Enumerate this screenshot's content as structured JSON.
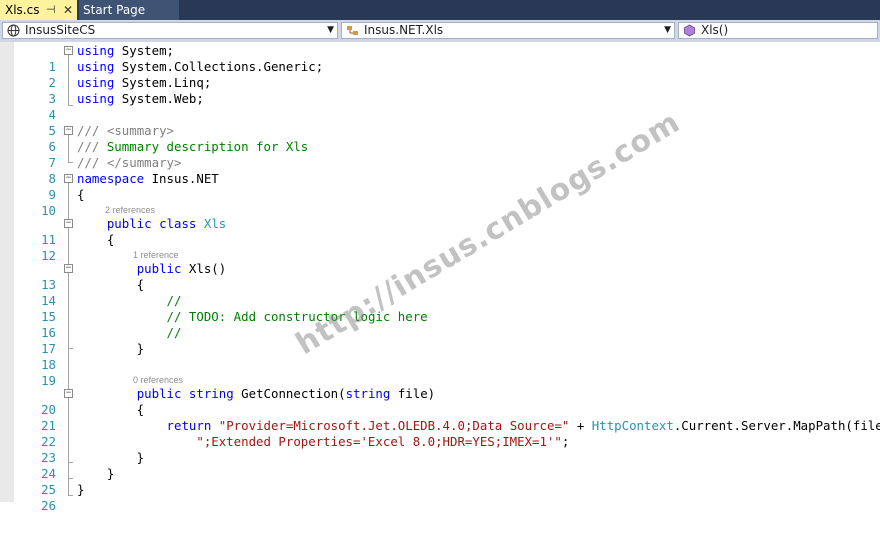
{
  "tabs": [
    {
      "label": "Xls.cs",
      "pin": "⊣",
      "close": "✕",
      "active": true
    },
    {
      "label": "Start Page",
      "active": false
    }
  ],
  "nav": {
    "project": {
      "icon": "globe-icon",
      "label": "InsusSiteCS"
    },
    "type": {
      "icon": "class-icon",
      "label": "Insus.NET.Xls"
    },
    "member": {
      "icon": "method-icon",
      "label": "Xls()"
    }
  },
  "codelens": {
    "l11": "2 references",
    "l13": "1 reference",
    "l20": "0 references"
  },
  "code_lines": [
    {
      "n": "1",
      "text": "using System;"
    },
    {
      "n": "2",
      "text": "using System.Collections.Generic;"
    },
    {
      "n": "3",
      "text": "using System.Linq;"
    },
    {
      "n": "4",
      "text": "using System.Web;"
    },
    {
      "n": "5",
      "text": ""
    },
    {
      "n": "6",
      "text": "/// <summary>"
    },
    {
      "n": "7",
      "text": "/// Summary description for Xls"
    },
    {
      "n": "8",
      "text": "/// </summary>"
    },
    {
      "n": "9",
      "text": "namespace Insus.NET"
    },
    {
      "n": "10",
      "text": "{"
    },
    {
      "n": "11",
      "text": "    public class Xls"
    },
    {
      "n": "12",
      "text": "    {"
    },
    {
      "n": "13",
      "text": "        public Xls()"
    },
    {
      "n": "14",
      "text": "        {"
    },
    {
      "n": "15",
      "text": "            //"
    },
    {
      "n": "16",
      "text": "            // TODO: Add constructor logic here"
    },
    {
      "n": "17",
      "text": "            //"
    },
    {
      "n": "18",
      "text": "        }"
    },
    {
      "n": "19",
      "text": ""
    },
    {
      "n": "20",
      "text": "        public string GetConnection(string file)"
    },
    {
      "n": "21",
      "text": "        {"
    },
    {
      "n": "22",
      "text": "            return \"Provider=Microsoft.Jet.OLEDB.4.0;Data Source=\" + HttpContext.Current.Server.MapPath(file) +"
    },
    {
      "n": "23",
      "text": "                \";Extended Properties='Excel 8.0;HDR=YES;IMEX=1'\";"
    },
    {
      "n": "24",
      "text": "        }"
    },
    {
      "n": "25",
      "text": "    }"
    },
    {
      "n": "26",
      "text": "}"
    }
  ],
  "watermark": "http://insus.cnblogs.com"
}
